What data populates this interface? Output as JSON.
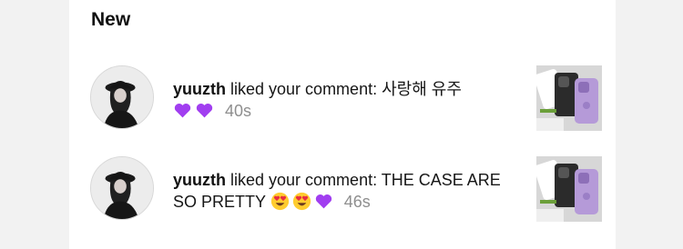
{
  "section": {
    "title": "New"
  },
  "notifications": [
    {
      "username": "yuuzth",
      "action": "liked your comment:",
      "comment": "사랑해 유주",
      "emojis": [
        "purple-heart-emoji",
        "purple-heart-emoji"
      ],
      "time": "40s"
    },
    {
      "username": "yuuzth",
      "action": "liked your comment:",
      "comment": "THE CASE ARE SO PRETTY",
      "emojis": [
        "heart-eyes-emoji",
        "heart-eyes-emoji",
        "purple-heart-emoji"
      ],
      "time": "46s"
    }
  ],
  "colors": {
    "purple_heart": "#a13ef0",
    "emoji_face": "#ffcc2e",
    "emoji_heart_red": "#e82e3f",
    "timestamp": "#8e8e8e"
  }
}
